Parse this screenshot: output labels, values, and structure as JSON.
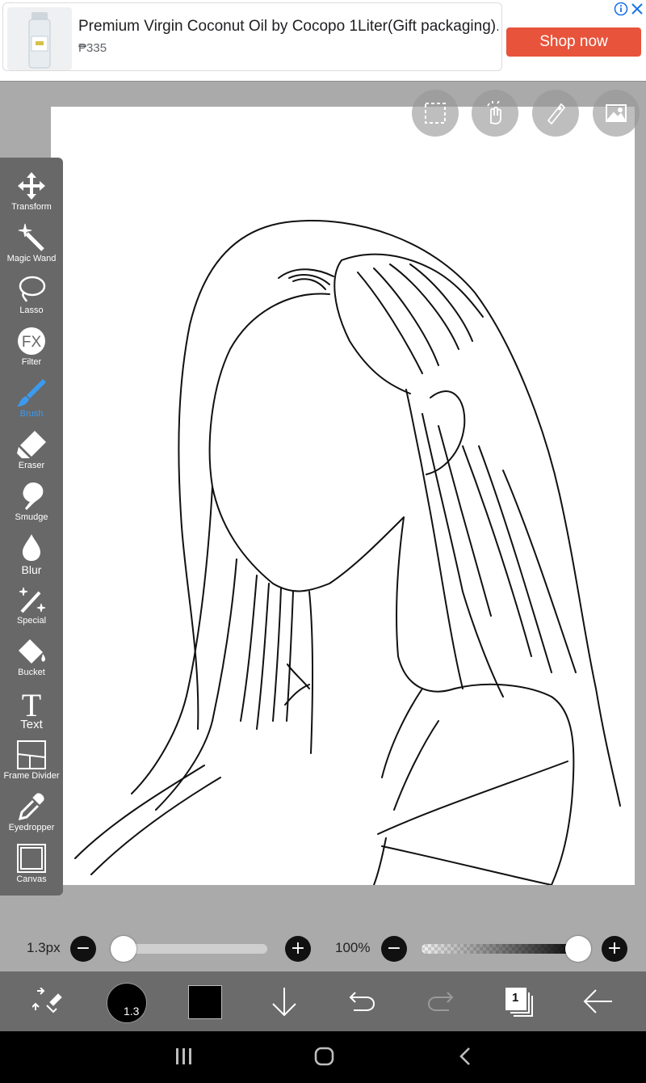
{
  "ad": {
    "title": "Premium Virgin Coconut Oil by Cocopo 1Liter(Gift packaging)...",
    "price": "₱335",
    "cta": "Shop now",
    "cta_color": "#e8533b",
    "icons": [
      "info-icon",
      "close-icon"
    ]
  },
  "canvas_top_buttons": [
    "selection-icon",
    "touch-gesture-icon",
    "ruler-icon",
    "image-icon"
  ],
  "toolbar": {
    "active_tool": "Brush",
    "accent_color": "#3b9af0",
    "tools": [
      {
        "label": "Transform",
        "icon": "transform-icon"
      },
      {
        "label": "Magic Wand",
        "icon": "magic-wand-icon"
      },
      {
        "label": "Lasso",
        "icon": "lasso-icon"
      },
      {
        "label": "Filter",
        "icon": "fx-icon"
      },
      {
        "label": "Brush",
        "icon": "brush-icon"
      },
      {
        "label": "Eraser",
        "icon": "eraser-icon"
      },
      {
        "label": "Smudge",
        "icon": "smudge-icon"
      },
      {
        "label": "Blur",
        "icon": "blur-icon"
      },
      {
        "label": "Special",
        "icon": "special-icon"
      },
      {
        "label": "Bucket",
        "icon": "bucket-icon"
      },
      {
        "label": "Text",
        "icon": "text-icon"
      },
      {
        "label": "Frame Divider",
        "icon": "frame-divider-icon"
      },
      {
        "label": "Eyedropper",
        "icon": "eyedropper-icon"
      },
      {
        "label": "Canvas",
        "icon": "canvas-icon"
      }
    ]
  },
  "brush_size": {
    "label": "1.3px",
    "value_fraction": 0.0
  },
  "opacity": {
    "label": "100%",
    "value_fraction": 1.0
  },
  "bottom_bar": {
    "brush_badge": "1.3",
    "current_color": "#000000",
    "layer_count": "1",
    "icons": [
      "swap-icon",
      "brush-size-icon",
      "color-swatch",
      "download-icon",
      "undo-icon",
      "redo-icon",
      "layers-icon",
      "back-arrow-icon"
    ]
  },
  "navbar": {
    "icons": [
      "recents-icon",
      "home-icon",
      "back-icon"
    ]
  }
}
